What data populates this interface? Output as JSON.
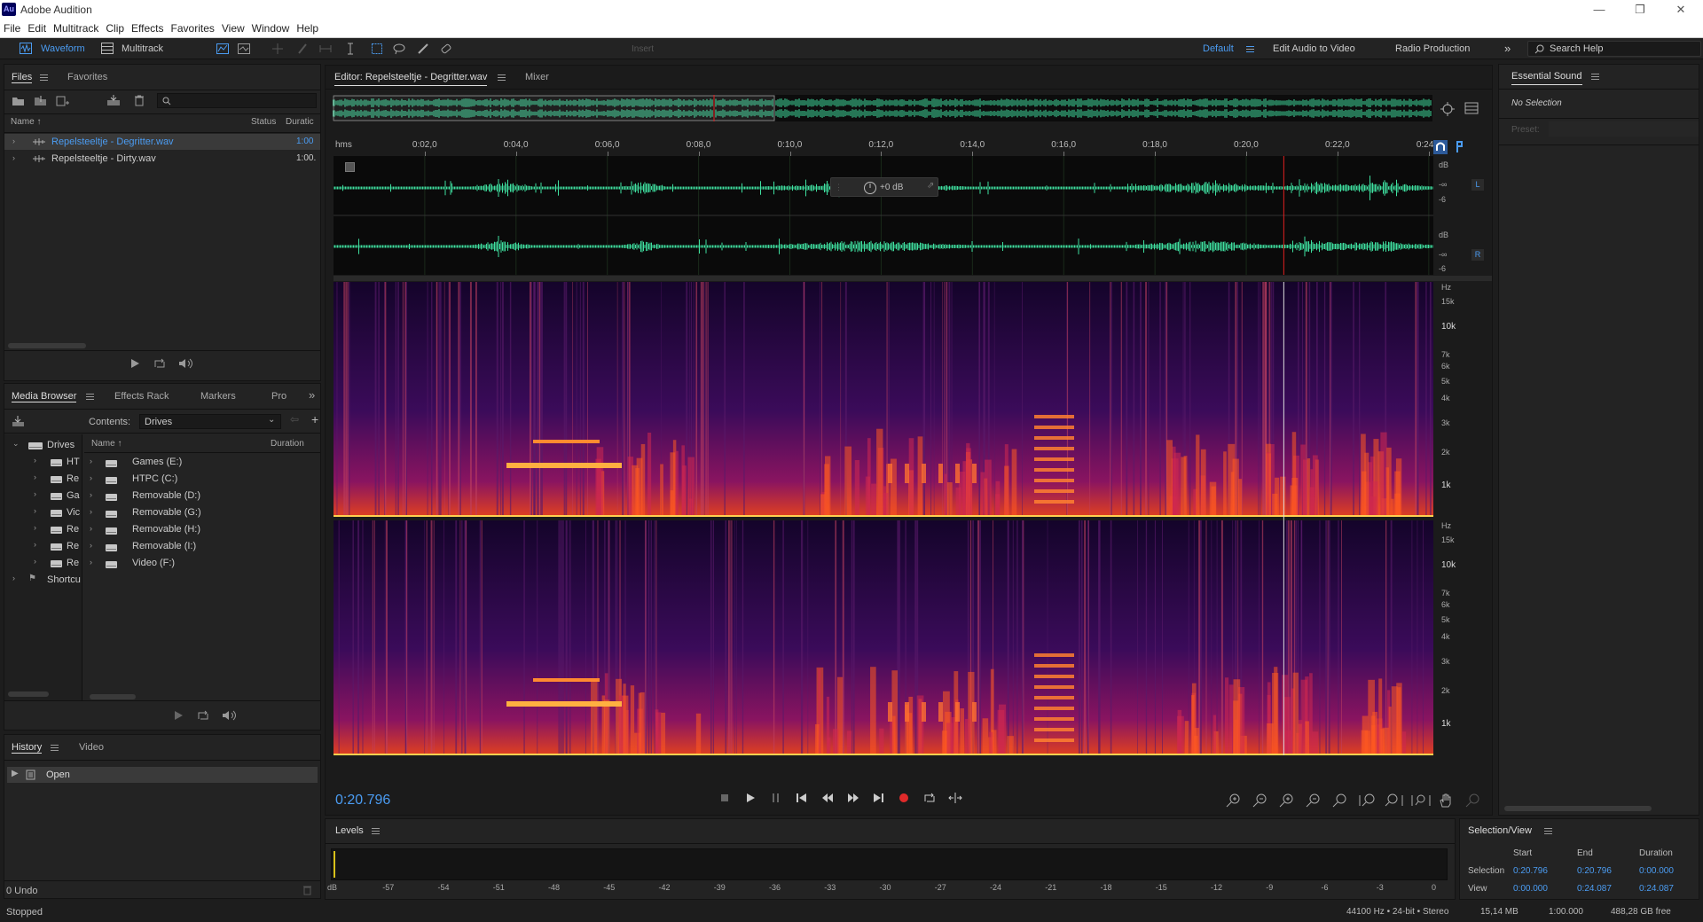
{
  "app": {
    "title": "Adobe Audition",
    "logo": "Au"
  },
  "menu": [
    "File",
    "Edit",
    "Multitrack",
    "Clip",
    "Effects",
    "Favorites",
    "View",
    "Window",
    "Help"
  ],
  "toolbar": {
    "waveform": "Waveform",
    "multitrack": "Multitrack",
    "insert": "Insert",
    "workspaces": [
      "Default",
      "Edit Audio to Video",
      "Radio Production"
    ],
    "search_placeholder": "Search Help"
  },
  "files_panel": {
    "tabs": [
      "Files",
      "Favorites"
    ],
    "headers": {
      "name": "Name",
      "status": "Status",
      "duration": "Duratic"
    },
    "files": [
      {
        "name": "Repelsteeltje - Degritter.wav",
        "duration": "1:00",
        "selected": true
      },
      {
        "name": "Repelsteeltje - Dirty.wav",
        "duration": "1:00.",
        "selected": false
      }
    ]
  },
  "media_browser": {
    "tabs": [
      "Media Browser",
      "Effects Rack",
      "Markers",
      "Pro"
    ],
    "contents_label": "Contents:",
    "contents_value": "Drives",
    "tree_root": "Drives",
    "tree_items": [
      "HT",
      "Re",
      "Ga",
      "Vic",
      "Re",
      "Re",
      "Re"
    ],
    "tree_shortcuts": "Shortcu",
    "headers": {
      "name": "Name",
      "duration": "Duration"
    },
    "drives": [
      "Games (E:)",
      "HTPC (C:)",
      "Removable (D:)",
      "Removable (G:)",
      "Removable (H:)",
      "Removable (I:)",
      "Video (F:)"
    ]
  },
  "history_panel": {
    "tabs": [
      "History",
      "Video"
    ],
    "items": [
      "Open"
    ],
    "undo": "0 Undo"
  },
  "editor": {
    "tab_label": "Editor: Repelsteeltje - Degritter.wav",
    "mixer_label": "Mixer",
    "time_units": "hms",
    "ruler": [
      "0:02,0",
      "0:04,0",
      "0:06,0",
      "0:08,0",
      "0:10,0",
      "0:12,0",
      "0:14,0",
      "0:16,0",
      "0:18,0",
      "0:20,0",
      "0:22,0",
      "0:24"
    ],
    "gain": "+0 dB",
    "db_scale": {
      "unit": "dB",
      "inf": "-∞",
      "six": "-6"
    },
    "channels": [
      "L",
      "R"
    ],
    "hz_scale": [
      "Hz",
      "15k",
      "10k",
      "7k",
      "6k",
      "5k",
      "4k",
      "3k",
      "2k",
      "1k"
    ],
    "current_time": "0:20.796",
    "playhead_fraction": 0.864
  },
  "levels": {
    "title": "Levels",
    "scale": [
      "dB",
      "-57",
      "-54",
      "-51",
      "-48",
      "-45",
      "-42",
      "-39",
      "-36",
      "-33",
      "-30",
      "-27",
      "-24",
      "-21",
      "-18",
      "-15",
      "-12",
      "-9",
      "-6",
      "-3",
      "0"
    ]
  },
  "essential_sound": {
    "title": "Essential Sound",
    "status": "No Selection",
    "preset_label": "Preset:"
  },
  "selection_view": {
    "title": "Selection/View",
    "headers": [
      "Start",
      "End",
      "Duration"
    ],
    "selection": {
      "label": "Selection",
      "start": "0:20.796",
      "end": "0:20.796",
      "duration": "0:00.000"
    },
    "view": {
      "label": "View",
      "start": "0:00.000",
      "end": "0:24.087",
      "duration": "0:24.087"
    }
  },
  "status_bar": {
    "state": "Stopped",
    "format": "44100 Hz • 24-bit • Stereo",
    "size": "15,14 MB",
    "duration": "1:00.000",
    "free": "488,28 GB free"
  },
  "colors": {
    "accent": "#4b9cf2",
    "waveform": "#3fe0a0",
    "playhead": "#e02020",
    "spectro_low": "#1a0530",
    "spectro_high": "#ffd050"
  }
}
